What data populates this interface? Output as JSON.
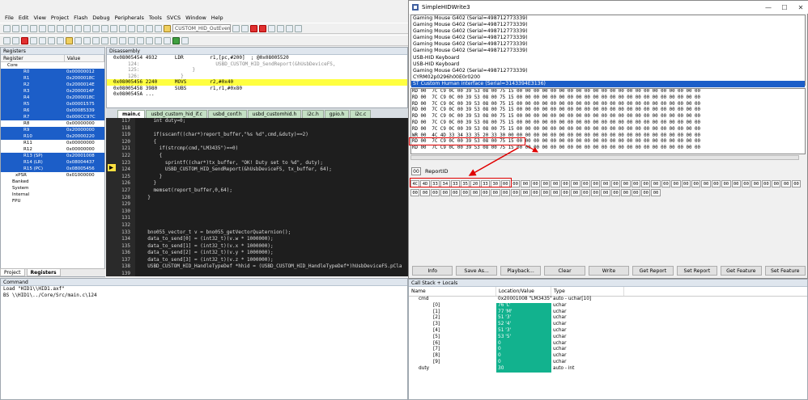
{
  "ide": {
    "menu": [
      "File",
      "Edit",
      "View",
      "Project",
      "Flash",
      "Debug",
      "Peripherals",
      "Tools",
      "SVCS",
      "Window",
      "Help"
    ],
    "target_combo": "CUSTOM_HID_OutEvent_",
    "registers": {
      "title": "Registers",
      "col_register": "Register",
      "col_value": "Value",
      "group": "Core",
      "rows": [
        {
          "n": "R0",
          "v": "0x00000012",
          "sel": true
        },
        {
          "n": "R1",
          "v": "0x2000018C",
          "sel": true
        },
        {
          "n": "R2",
          "v": "0x2000014E",
          "sel": true
        },
        {
          "n": "R3",
          "v": "0x2000014F",
          "sel": true
        },
        {
          "n": "R4",
          "v": "0x2000018C",
          "sel": true
        },
        {
          "n": "R5",
          "v": "0x00001575",
          "sel": true
        },
        {
          "n": "R6",
          "v": "0x00085339",
          "sel": true
        },
        {
          "n": "R7",
          "v": "0x000CC97C",
          "sel": true
        },
        {
          "n": "R8",
          "v": "0x00000000",
          "sel": false
        },
        {
          "n": "R9",
          "v": "0x20000000",
          "sel": true
        },
        {
          "n": "R10",
          "v": "0x20000220",
          "sel": true
        },
        {
          "n": "R11",
          "v": "0x00000000",
          "sel": false
        },
        {
          "n": "R12",
          "v": "0x00000000",
          "sel": false
        },
        {
          "n": "R13 (SP)",
          "v": "0x20001008",
          "sel": true
        },
        {
          "n": "R14 (LR)",
          "v": "0x08004437",
          "sel": true
        },
        {
          "n": "R15 (PC)",
          "v": "0x08005456",
          "sel": true
        },
        {
          "n": "xPSR",
          "v": "0x01000000",
          "sel": false
        }
      ],
      "groups": [
        "Banked",
        "System",
        "Internal",
        "FPU"
      ],
      "tab_project": "Project",
      "tab_registers": "Registers"
    },
    "disassembly": {
      "title": "Disassembly",
      "lines": [
        {
          "t": "0x08005454 4932      LDR         r1,[pc,#200]  ; @0x08005520",
          "cls": ""
        },
        {
          "t": "     124:                          USBD_CUSTOM_HID_SendReport(&hUsbDeviceFS,",
          "cls": "src"
        },
        {
          "t": "     125:                  }",
          "cls": "src"
        },
        {
          "t": "     126:              }",
          "cls": "src"
        },
        {
          "t": "0x08005456 2240      MOVS        r2,#0x40",
          "cls": "hl"
        },
        {
          "t": "0x08005458 3980      SUBS        r1,r1,#0x80",
          "cls": ""
        },
        {
          "t": "0x0800545A ...",
          "cls": ""
        }
      ]
    },
    "file_tabs": [
      "main.c",
      "usbd_custom_hid_if.c",
      "usbd_conf.h",
      "usbd_customhid.h",
      "i2c.h",
      "gpio.h",
      "i2c.c"
    ],
    "code": [
      {
        "ln": "117",
        "c": "    int duty=0;"
      },
      {
        "ln": "118",
        "c": ""
      },
      {
        "ln": "119",
        "c": "    if(sscanf((char*)report_buffer,\"%s %d\",cmd,&duty)==2)"
      },
      {
        "ln": "120",
        "c": "    {"
      },
      {
        "ln": "121",
        "c": "      if(strcmp(cmd,\"LM3435\")==0)"
      },
      {
        "ln": "122",
        "c": "      {"
      },
      {
        "ln": "123",
        "c": "        sprintf((char*)tx_buffer, \"OK! Duty set to %d\", duty);"
      },
      {
        "ln": "124",
        "c": "        USBD_CUSTOM_HID_SendReport(&hUsbDeviceFS, tx_buffer, 64);"
      },
      {
        "ln": "125",
        "c": "      }"
      },
      {
        "ln": "126",
        "c": "    }"
      },
      {
        "ln": "127",
        "c": "    memset(report_buffer,0,64);"
      },
      {
        "ln": "128",
        "c": "  }"
      },
      {
        "ln": "129",
        "c": ""
      },
      {
        "ln": "130",
        "c": ""
      },
      {
        "ln": "131",
        "c": ""
      },
      {
        "ln": "132",
        "c": ""
      },
      {
        "ln": "133",
        "c": "  bno055_vector_t v = bno055_getVectorQuaternion();"
      },
      {
        "ln": "134",
        "c": "  data_to_send[0] = (int32_t)(v.w * 1000000);"
      },
      {
        "ln": "135",
        "c": "  data_to_send[1] = (int32_t)(v.x * 1000000);"
      },
      {
        "ln": "136",
        "c": "  data_to_send[2] = (int32_t)(v.y * 1000000);"
      },
      {
        "ln": "137",
        "c": "  data_to_send[3] = (int32_t)(v.z * 1000000);"
      },
      {
        "ln": "138",
        "c": "  USBD_CUSTOM_HID_HandleTypeDef *hhid = (USBD_CUSTOM_HID_HandleTypeDef*)hUsbDeviceFS.pCla"
      },
      {
        "ln": "139",
        "c": ""
      }
    ],
    "command": {
      "title": "Command",
      "lines": [
        "Load \"HID1\\\\HID1.axf\"",
        "BS \\\\HID1\\../Core/Src/main.c\\124"
      ]
    }
  },
  "hid": {
    "title": "SimpleHIDWrite3",
    "devices": [
      {
        "t": "Gaming Mouse G402 (Serial=498712773339)",
        "sel": false
      },
      {
        "t": "Gaming Mouse G402 (Serial=498712773339)",
        "sel": false
      },
      {
        "t": "Gaming Mouse G402 (Serial=498712773339)",
        "sel": false
      },
      {
        "t": "Gaming Mouse G402 (Serial=498712773339)",
        "sel": false
      },
      {
        "t": "Gaming Mouse G402 (Serial=498712773339)",
        "sel": false
      },
      {
        "t": "Gaming Mouse G402 (Serial=498712773339)",
        "sel": false
      },
      {
        "t": "USB-HID Keyboard",
        "sel": false
      },
      {
        "t": "USB-HID Keyboard",
        "sel": false
      },
      {
        "t": "Gaming Mouse G402 (Serial=498712773339)",
        "sel": false
      },
      {
        "t": "CYRM02p0296h00E0r0200",
        "sel": false
      },
      {
        "t": "ST Custom Human interface (Serial=3143394E3136)",
        "sel": true
      }
    ],
    "log": [
      "RD 00  7C C9 0C 00 39 53 08 00 75 15 00 00 00 00 00 00 00 00 00 00 00 00 00 00 00 00 00 00 00 00 00 00",
      "RD 00  7C C9 0C 00 39 53 08 00 75 15 00 00 00 00 00 00 00 00 00 00 00 00 00 00 00 00 00 00 00 00 00 00",
      "RD 00  7C C9 0C 00 39 53 08 00 75 15 00 00 00 00 00 00 00 00 00 00 00 00 00 00 00 00 00 00 00 00 00 00",
      "RD 00  7C C9 0C 00 39 53 08 00 75 15 00 00 00 00 00 00 00 00 00 00 00 00 00 00 00 00 00 00 00 00 00 00",
      "RD 00  7C C9 0C 00 39 53 08 00 75 15 00 00 00 00 00 00 00 00 00 00 00 00 00 00 00 00 00 00 00 00 00 00",
      "RD 00  7C C9 0C 00 39 53 08 00 75 15 00 00 00 00 00 00 00 00 00 00 00 00 00 00 00 00 00 00 00 00 00 00",
      "RD 00  7C C9 0C 00 39 53 08 00 75 15 00 00 00 00 00 00 00 00 00 00 00 00 00 00 00 00 00 00 00 00 00 00",
      "WR 00  4C 4D 33 34 33 35 20 33 30 00 00 00 00 00 00 00 00 00 00 00 00 00 00 00 00 00 00 00 00 00 00 00",
      "RD 00  7C C9 0C 00 39 53 08 00 75 15 00 00 00 00 00 00 00 00 00 00 00 00 00 00 00 00 00 00 00 00 00 00",
      "RD 00  7C C9 0C 00 39 53 08 00 75 15 00 00 00 00 00 00 00 00 00 00 00 00 00 00 00 00 00 00 00 00 00 00"
    ],
    "report_id_value": "00",
    "report_id_label": "ReportID",
    "bytes": [
      "4C",
      "4D",
      "33",
      "34",
      "33",
      "35",
      "20",
      "33",
      "30",
      "00",
      "00",
      "00",
      "00",
      "00",
      "00",
      "00",
      "00",
      "00",
      "00",
      "00",
      "00",
      "00",
      "00",
      "00",
      "00",
      "00",
      "00",
      "00",
      "00",
      "00",
      "00",
      "00",
      "00",
      "00",
      "00",
      "00",
      "00",
      "00",
      "00",
      "00",
      "00",
      "00",
      "00",
      "00",
      "00",
      "00",
      "00",
      "00",
      "00",
      "00",
      "00",
      "00",
      "00",
      "00",
      "00",
      "00",
      "00",
      "00",
      "00",
      "00",
      "00",
      "00",
      "00",
      "00"
    ],
    "buttons": [
      "Info",
      "Save As...",
      "Playback...",
      "Clear",
      "Write",
      "Get Report",
      "Set Report",
      "Get Feature",
      "Set Feature"
    ]
  },
  "callstack": {
    "title": "Call Stack + Locals",
    "col_name": "Name",
    "col_value": "Location/Value",
    "col_type": "Type",
    "rows": [
      {
        "a": "cmd",
        "b": "0x20001008 \"LM3435\"",
        "c": "auto - uchar[10]",
        "teal": false,
        "indent": 12
      },
      {
        "a": "[0]",
        "b": "76 'L'",
        "c": "uchar",
        "teal": true,
        "indent": 30
      },
      {
        "a": "[1]",
        "b": "77 'M'",
        "c": "uchar",
        "teal": true,
        "indent": 30
      },
      {
        "a": "[2]",
        "b": "51 '3'",
        "c": "uchar",
        "teal": true,
        "indent": 30
      },
      {
        "a": "[3]",
        "b": "52 '4'",
        "c": "uchar",
        "teal": true,
        "indent": 30
      },
      {
        "a": "[4]",
        "b": "51 '3'",
        "c": "uchar",
        "teal": true,
        "indent": 30
      },
      {
        "a": "[5]",
        "b": "53 '5'",
        "c": "uchar",
        "teal": true,
        "indent": 30
      },
      {
        "a": "[6]",
        "b": "0",
        "c": "uchar",
        "teal": true,
        "indent": 30
      },
      {
        "a": "[7]",
        "b": "0",
        "c": "uchar",
        "teal": true,
        "indent": 30
      },
      {
        "a": "[8]",
        "b": "0",
        "c": "uchar",
        "teal": true,
        "indent": 30
      },
      {
        "a": "[9]",
        "b": "0",
        "c": "uchar",
        "teal": true,
        "indent": 30
      },
      {
        "a": "duty",
        "b": "30",
        "c": "auto - int",
        "teal": true,
        "indent": 12
      }
    ]
  }
}
